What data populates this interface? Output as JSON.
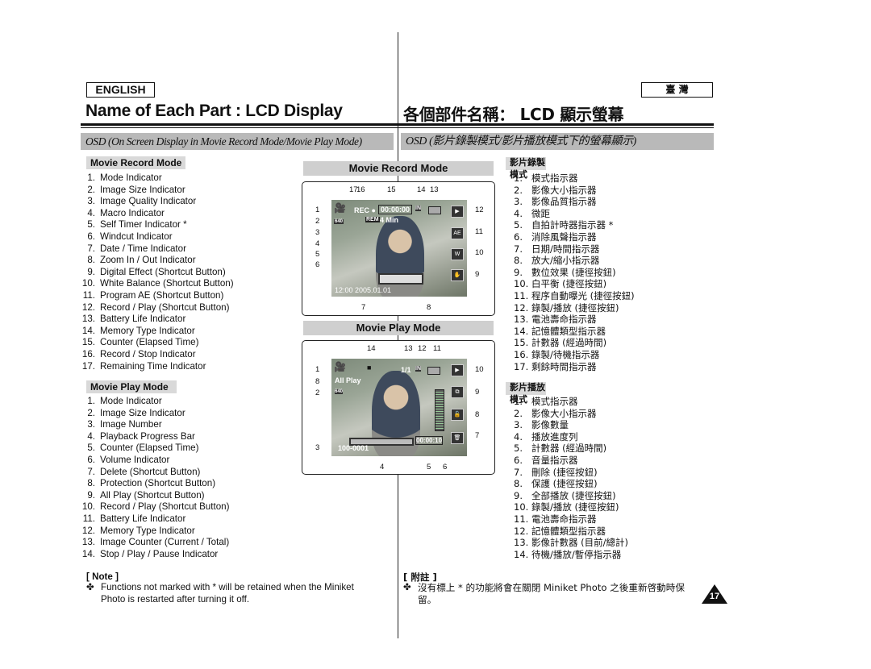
{
  "header": {
    "lang_en": "ENGLISH",
    "lang_zh": "臺 灣",
    "title_en": "Name of Each Part : LCD Display",
    "title_zh": "各個部件名稱： LCD 顯示螢幕"
  },
  "osd": {
    "en": "OSD (On Screen Display in Movie Record Mode/Movie Play Mode)",
    "zh": "OSD (影片錄製模式/影片播放模式下的螢幕顯示)"
  },
  "en": {
    "record_label": "Movie Record Mode",
    "record_items": [
      "Mode Indicator",
      "Image Size Indicator",
      "Image Quality Indicator",
      "Macro Indicator",
      "Self Timer Indicator *",
      "Windcut Indicator",
      "Date / Time Indicator",
      "Zoom In / Out Indicator",
      "Digital Effect (Shortcut Button)",
      "White Balance (Shortcut Button)",
      "Program AE (Shortcut Button)",
      "Record / Play (Shortcut Button)",
      "Battery Life Indicator",
      "Memory Type Indicator",
      "Counter (Elapsed Time)",
      "Record / Stop Indicator",
      "Remaining Time Indicator"
    ],
    "play_label": "Movie Play Mode",
    "play_items": [
      "Mode Indicator",
      "Image Size Indicator",
      "Image Number",
      "Playback Progress Bar",
      "Counter (Elapsed Time)",
      "Volume Indicator",
      "Delete (Shortcut Button)",
      "Protection (Shortcut Button)",
      "All Play (Shortcut Button)",
      "Record / Play (Shortcut Button)",
      "Battery Life Indicator",
      "Memory Type Indicator",
      "Image Counter (Current / Total)",
      "Stop / Play / Pause Indicator"
    ],
    "note_title": "[ Note ]",
    "note_text": "Functions not marked with * will be retained when the Miniket Photo is restarted after turning it off."
  },
  "zh": {
    "record_label": "影片錄製模式",
    "record_items": [
      "模式指示器",
      "影像大小指示器",
      "影像品質指示器",
      "微距",
      "自拍計時器指示器 *",
      "消除風聲指示器",
      "日期/時間指示器",
      "放大/縮小指示器",
      "數位效果 (捷徑按鈕)",
      "白平衡 (捷徑按鈕)",
      "程序自動曝光 (捷徑按鈕)",
      "錄製/播放 (捷徑按鈕)",
      "電池壽命指示器",
      "記憶體類型指示器",
      "計數器 (經過時間)",
      "錄製/待機指示器",
      "剩餘時間指示器"
    ],
    "play_label": "影片播放模式",
    "play_items": [
      "模式指示器",
      "影像大小指示器",
      "影像數量",
      "播放進度列",
      "計數器 (經過時間)",
      "音量指示器",
      "刪除 (捷徑按鈕)",
      "保護 (捷徑按鈕)",
      "全部播放 (捷徑按鈕)",
      "錄製/播放 (捷徑按鈕)",
      "電池壽命指示器",
      "記憶體類型指示器",
      "影像計數器 (目前/總計)",
      "待機/播放/暫停指示器"
    ],
    "note_title": "[ 附註 ]",
    "note_text": "沒有標上 * 的功能將會在關閉 Miniket Photo 之後重新啓動時保留。"
  },
  "diagram_record": {
    "title": "Movie Record Mode",
    "osd": {
      "rec": "REC ●",
      "counter": "00:00:00",
      "rem": "REM",
      "remaining": "4 Min",
      "memory": "IN",
      "date": "12:00 2005.01.01",
      "size": "640"
    },
    "callouts": {
      "top": [
        "17",
        "16",
        "15",
        "14",
        "13"
      ],
      "left": [
        "1",
        "2",
        "3",
        "4",
        "5",
        "6"
      ],
      "right": [
        "12",
        "11",
        "10",
        "9"
      ],
      "bottom": [
        "7",
        "8"
      ]
    }
  },
  "diagram_play": {
    "title": "Movie Play Mode",
    "osd": {
      "mode": "All Play",
      "counter_img": "1/1",
      "memory": "IN",
      "image_no": "100-0001",
      "elapsed": "00:00:10",
      "size": "640"
    },
    "callouts": {
      "top": [
        "14",
        "13",
        "12",
        "11"
      ],
      "left": [
        "1",
        "8",
        "2",
        "3"
      ],
      "right": [
        "10",
        "9",
        "8",
        "7"
      ],
      "bottom": [
        "4",
        "5",
        "6"
      ]
    }
  },
  "page_number": "17"
}
